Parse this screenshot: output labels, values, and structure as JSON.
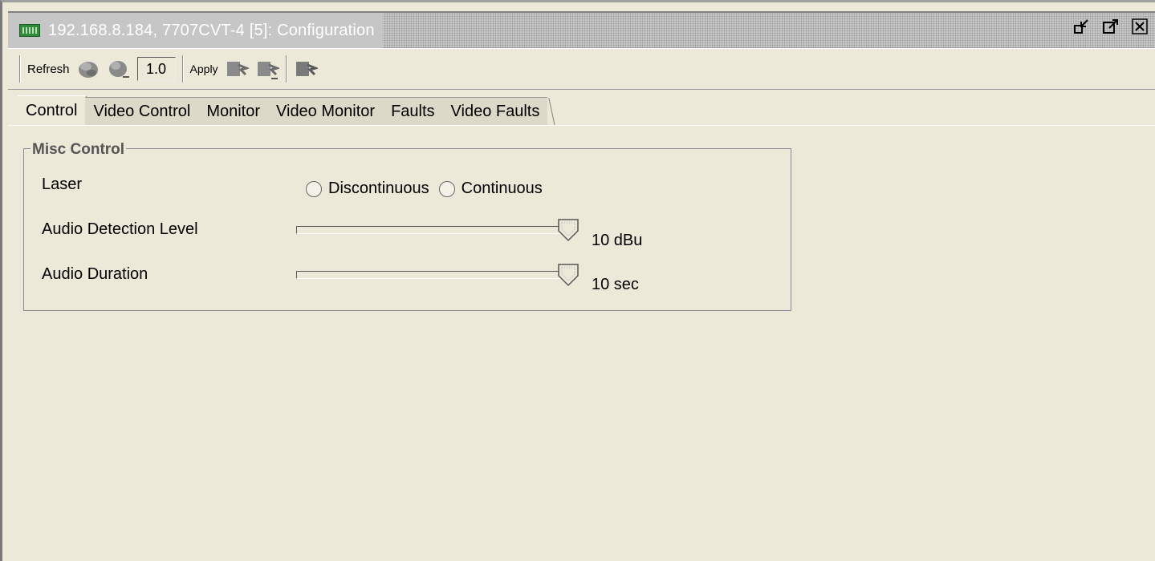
{
  "window": {
    "title": "192.168.8.184, 7707CVT-4  [5]: Configuration"
  },
  "toolbar": {
    "refresh_label": "Refresh",
    "version_value": "1.0",
    "apply_label": "Apply"
  },
  "tabs": [
    {
      "label": "Control",
      "active": true
    },
    {
      "label": "Video Control",
      "active": false
    },
    {
      "label": "Monitor",
      "active": false
    },
    {
      "label": "Video Monitor",
      "active": false
    },
    {
      "label": "Faults",
      "active": false
    },
    {
      "label": "Video Faults",
      "active": false
    }
  ],
  "misc_control": {
    "title": "Misc Control",
    "laser": {
      "label": "Laser",
      "options": [
        "Discontinuous",
        "Continuous"
      ],
      "selected": null
    },
    "audio_detection_level": {
      "label": "Audio Detection Level",
      "value_text": "10 dBu",
      "position_fraction": 1.0
    },
    "audio_duration": {
      "label": "Audio Duration",
      "value_text": "10 sec",
      "position_fraction": 1.0
    }
  },
  "colors": {
    "background": "#ece9d8",
    "title_text": "#ffffff",
    "group_title": "#555555"
  }
}
